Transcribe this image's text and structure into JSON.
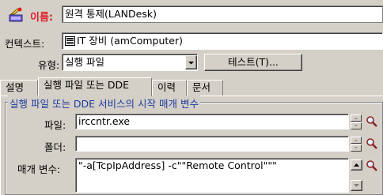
{
  "header": {
    "name_label": "이름:",
    "name_value": "원격 통제(LANDesk)",
    "context_label": "컨텍스트:",
    "context_value": "IT 장비 (amComputer)",
    "type_label": "유형:",
    "type_value": "실행 파일",
    "test_button": "테스트(T)..."
  },
  "tabs": [
    {
      "label": "설명"
    },
    {
      "label": "실행 파일 또는 DDE"
    },
    {
      "label": "이력"
    },
    {
      "label": "문서"
    }
  ],
  "group": {
    "title": "실행 파일 또는 DDE 서비스의 시작 매개 변수",
    "file_label": "파일:",
    "file_value": "irccntr.exe",
    "folder_label": "폴더:",
    "folder_value": "",
    "params_label": "매개 변수:",
    "params_value": "\"-a[TcpIpAddress] -c\"\"Remote Control\"\"\""
  },
  "colors": {
    "accent_red": "#e0202a",
    "group_title_blue": "#1e3a9e",
    "window_bg": "#d4d0c8"
  }
}
